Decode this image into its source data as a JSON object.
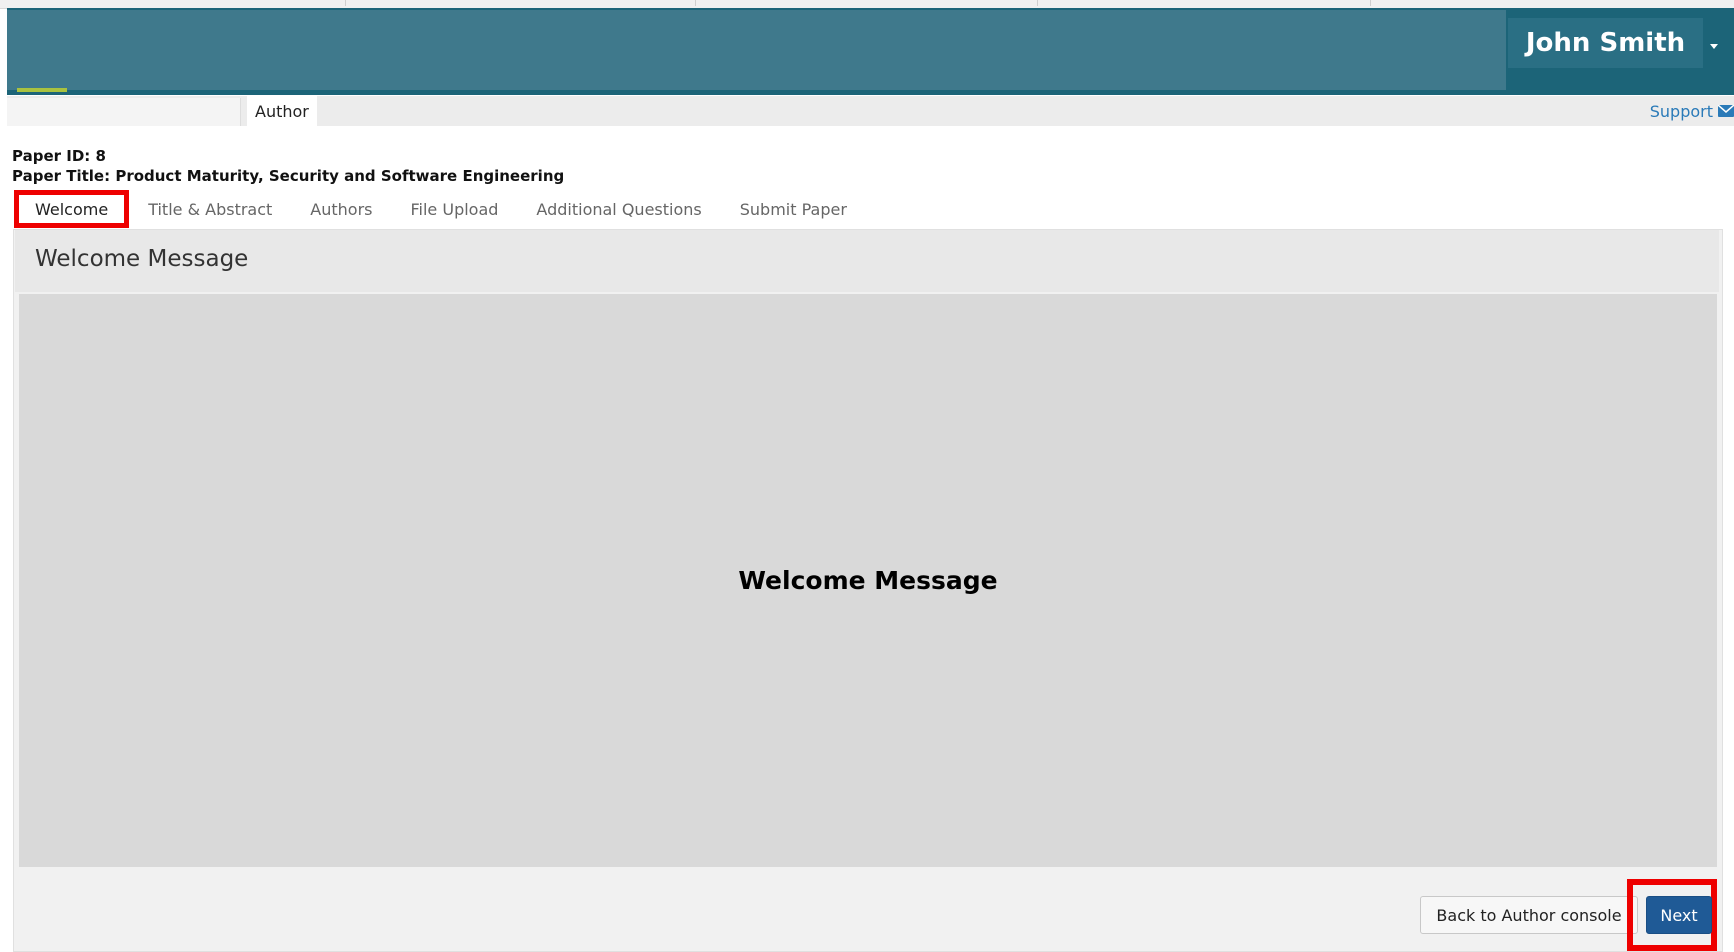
{
  "header": {
    "user_name": "John Smith"
  },
  "subnav": {
    "role_tab": "Author",
    "support_label": "Support"
  },
  "paper": {
    "id_line": "Paper ID: 8",
    "title_line": "Paper Title: Product Maturity, Security and Software Engineering"
  },
  "tabs": [
    {
      "label": "Welcome",
      "active": true
    },
    {
      "label": "Title & Abstract",
      "active": false
    },
    {
      "label": "Authors",
      "active": false
    },
    {
      "label": "File Upload",
      "active": false
    },
    {
      "label": "Additional Questions",
      "active": false
    },
    {
      "label": "Submit Paper",
      "active": false
    }
  ],
  "panel": {
    "title": "Welcome Message",
    "body_text": "Welcome Message"
  },
  "actions": {
    "back_label": "Back to Author console",
    "next_label": "Next"
  },
  "colors": {
    "header_bg": "#1c6478",
    "highlight": "#ee0000",
    "next_button": "#1f5a96",
    "link": "#2a7ab8"
  },
  "icons": {
    "support": "envelope-icon",
    "user_menu": "caret-down-icon"
  }
}
